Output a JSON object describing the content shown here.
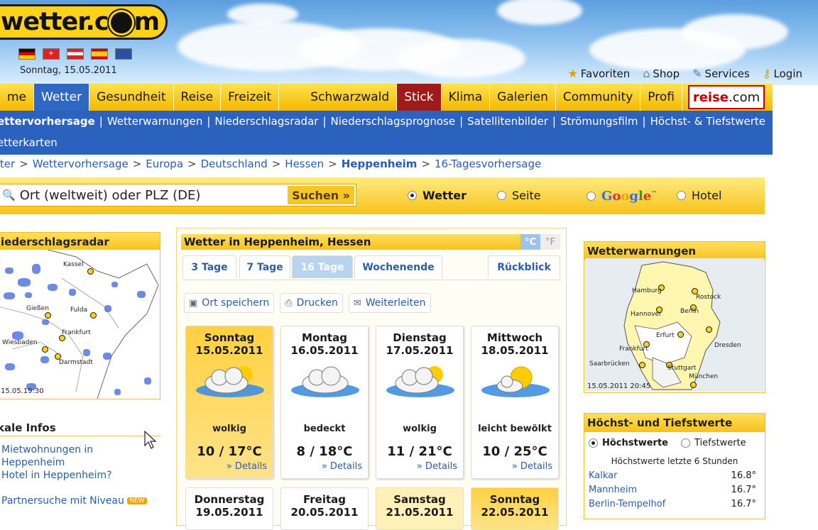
{
  "header": {
    "logo_text": "wetter.c",
    "logo_text2": "m",
    "date": "Sonntag, 15.05.2011",
    "flags": [
      "flag-de",
      "flag-ch",
      "flag-at",
      "flag-es",
      "flag-eu"
    ],
    "toplinks": [
      {
        "label": "Favoriten",
        "icon": "star-icon"
      },
      {
        "label": "Shop",
        "icon": "shop-icon"
      },
      {
        "label": "Services",
        "icon": "wrench-icon"
      },
      {
        "label": "Login",
        "icon": "key-icon"
      }
    ]
  },
  "nav": {
    "tabs": [
      "me",
      "Wetter",
      "Gesundheit",
      "Reise",
      "Freizeit",
      "Schwarzwald",
      "Stick",
      "Klima",
      "Galerien",
      "Community",
      "Profi"
    ],
    "reise_logo_1": "reise",
    "reise_logo_2": ".com"
  },
  "subnav": {
    "row1": [
      "ettervorhersage",
      "Wetterwarnungen",
      "Niederschlagsradar",
      "Niederschlagsprognose",
      "Satellitenbilder",
      "Strömungsfilm",
      "Höchst- & Tiefstwerte"
    ],
    "row2": "etterkarten",
    "sep": "|"
  },
  "breadcrumb": {
    "items": [
      "tter",
      "Wettervorhersage",
      "Europa",
      "Deutschland",
      "Hessen",
      "Heppenheim",
      "16-Tagesvorhersage"
    ],
    "sep": ">"
  },
  "search": {
    "placeholder": "Ort (weltweit) oder PLZ (DE)",
    "button": "Suchen »",
    "options": [
      "Wetter",
      "Seite",
      "Google",
      "Hotel"
    ],
    "google_tm": "™"
  },
  "radar": {
    "title": "iederschlagsradar",
    "cities": [
      "Kassel",
      "Gießen",
      "Fulda",
      "Frankfurt",
      "Wiesbaden",
      "Darmstadt"
    ],
    "time": "15.05.19:30"
  },
  "lokal": {
    "title": "kale Infos",
    "links": [
      "Mietwohnungen in Heppenheim",
      "Hotel in Heppenheim?",
      "Partnersuche mit Niveau"
    ],
    "new_badge": "NEW"
  },
  "forecast": {
    "title": "Wetter in Heppenheim, Hessen",
    "unit_c": "°C",
    "unit_f": "°F",
    "tabs": [
      "3 Tage",
      "7 Tage",
      "16 Tage",
      "Wochenende",
      "Rückblick"
    ],
    "actions": [
      "Ort speichern",
      "Drucken",
      "Weiterleiten"
    ],
    "details_label": "» Details",
    "days": [
      {
        "name": "Sonntag",
        "date": "15.05.2011",
        "cond": "wolkig",
        "temp": "10 / 17°C",
        "icon": "partly-cloudy-icon"
      },
      {
        "name": "Montag",
        "date": "16.05.2011",
        "cond": "bedeckt",
        "temp": "8 / 18°C",
        "icon": "cloudy-icon"
      },
      {
        "name": "Dienstag",
        "date": "17.05.2011",
        "cond": "wolkig",
        "temp": "11 / 21°C",
        "icon": "partly-cloudy-icon"
      },
      {
        "name": "Mittwoch",
        "date": "18.05.2011",
        "cond": "leicht bewölkt",
        "temp": "10 / 25°C",
        "icon": "mostly-sunny-icon"
      }
    ],
    "days_next": [
      {
        "name": "Donnerstag",
        "date": "19.05.2011"
      },
      {
        "name": "Freitag",
        "date": "20.05.2011"
      },
      {
        "name": "Samstag",
        "date": "21.05.2011"
      },
      {
        "name": "Sonntag",
        "date": "22.05.2011"
      }
    ]
  },
  "warnings": {
    "title": "Wetterwarnungen",
    "cities": [
      "Hamburg",
      "Rostock",
      "Berlin",
      "Hannover",
      "Erfurt",
      "Frankfurt",
      "Dresden",
      "Saarbrücken",
      "Stuttgart",
      "München"
    ],
    "timestamp": "15.05.2011 20:45"
  },
  "extremes": {
    "title": "Höchst- und Tiefstwerte",
    "options": [
      "Höchstwerte",
      "Tiefstwerte"
    ],
    "subtitle": "Höchstwerte letzte 6 Stunden",
    "rows": [
      {
        "name": "Kalkar",
        "value": "16.8°"
      },
      {
        "name": "Mannheim",
        "value": "16.7°"
      },
      {
        "name": "Berlin-Tempelhof",
        "value": "16.7°"
      }
    ]
  }
}
